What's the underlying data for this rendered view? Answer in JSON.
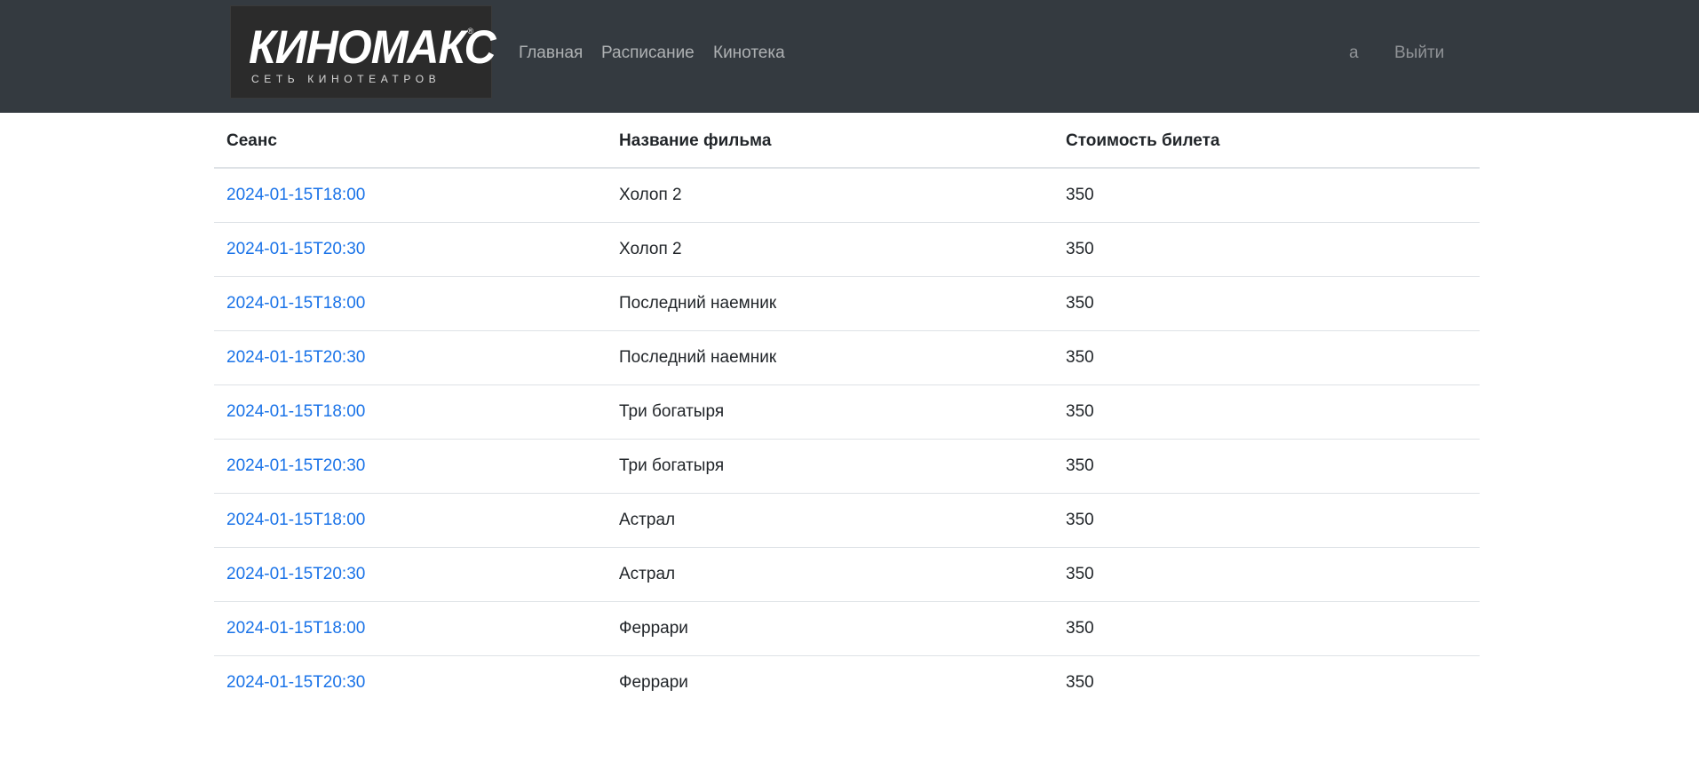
{
  "header": {
    "logo": {
      "brand": "КИНОМАКС",
      "registered": "®",
      "tagline": "СЕТЬ КИНОТЕАТРОВ"
    },
    "nav": {
      "home": "Главная",
      "schedule": "Расписание",
      "library": "Кинотека"
    },
    "user": "a",
    "logout": "Выйти"
  },
  "table": {
    "columns": [
      "Сеанс",
      "Название фильма",
      "Стоимость билета"
    ],
    "rows": [
      {
        "session": "2024-01-15T18:00",
        "film": "Холоп 2",
        "price": "350"
      },
      {
        "session": "2024-01-15T20:30",
        "film": "Холоп 2",
        "price": "350"
      },
      {
        "session": "2024-01-15T18:00",
        "film": "Последний наемник",
        "price": "350"
      },
      {
        "session": "2024-01-15T20:30",
        "film": "Последний наемник",
        "price": "350"
      },
      {
        "session": "2024-01-15T18:00",
        "film": "Три богатыря",
        "price": "350"
      },
      {
        "session": "2024-01-15T20:30",
        "film": "Три богатыря",
        "price": "350"
      },
      {
        "session": "2024-01-15T18:00",
        "film": "Астрал",
        "price": "350"
      },
      {
        "session": "2024-01-15T20:30",
        "film": "Астрал",
        "price": "350"
      },
      {
        "session": "2024-01-15T18:00",
        "film": "Феррари",
        "price": "350"
      },
      {
        "session": "2024-01-15T20:30",
        "film": "Феррари",
        "price": "350"
      }
    ]
  },
  "colors": {
    "navbar_bg": "#343a40",
    "link": "#1a73e8",
    "divider": "#dee2e6"
  }
}
